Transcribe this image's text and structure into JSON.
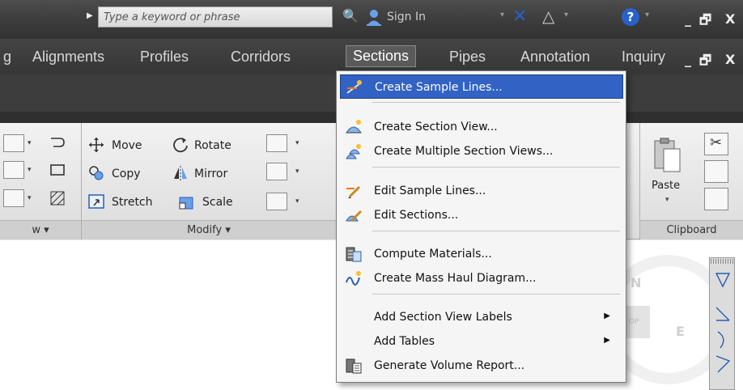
{
  "titlebar": {
    "search_placeholder": "Type a keyword or phrase",
    "sign_in": "Sign In",
    "minimize": "_",
    "restore": "🗗",
    "close": "X"
  },
  "menubar": {
    "items": [
      "g",
      "Alignments",
      "Profiles",
      "Corridors",
      "Sections",
      "Pipes",
      "Annotation",
      "Inquiry"
    ],
    "active": "Sections"
  },
  "ribbon": {
    "modify": {
      "move": "Move",
      "rotate": "Rotate",
      "copy": "Copy",
      "mirror": "Mirror",
      "stretch": "Stretch",
      "scale": "Scale",
      "panel_label": "Modify ▾"
    },
    "left_panel_label": "w ▾",
    "clipboard": {
      "paste": "Paste",
      "panel_label": "Clipboard"
    }
  },
  "compass": {
    "n": "N",
    "e": "E",
    "top": "OP"
  },
  "dropdown": {
    "items": [
      {
        "label": "Create Sample Lines...",
        "icon": "sample-lines-icon",
        "highlighted": true
      },
      {
        "label": "Create Section View...",
        "icon": "section-view-icon"
      },
      {
        "label": "Create Multiple Section Views...",
        "icon": "multiple-section-views-icon"
      },
      {
        "label": "Edit Sample Lines...",
        "icon": "edit-sample-lines-icon"
      },
      {
        "label": "Edit Sections...",
        "icon": "edit-sections-icon"
      },
      {
        "label": "Compute Materials...",
        "icon": "compute-materials-icon"
      },
      {
        "label": "Create Mass Haul Diagram...",
        "icon": "mass-haul-icon"
      },
      {
        "label": "Add Section View Labels",
        "submenu": true
      },
      {
        "label": "Add Tables",
        "submenu": true
      },
      {
        "label": "Generate Volume Report...",
        "icon": "volume-report-icon"
      }
    ]
  },
  "colors": {
    "highlight": "#3162c4",
    "title_bar": "#3a3a3a",
    "ribbon": "#e6e6e6"
  }
}
